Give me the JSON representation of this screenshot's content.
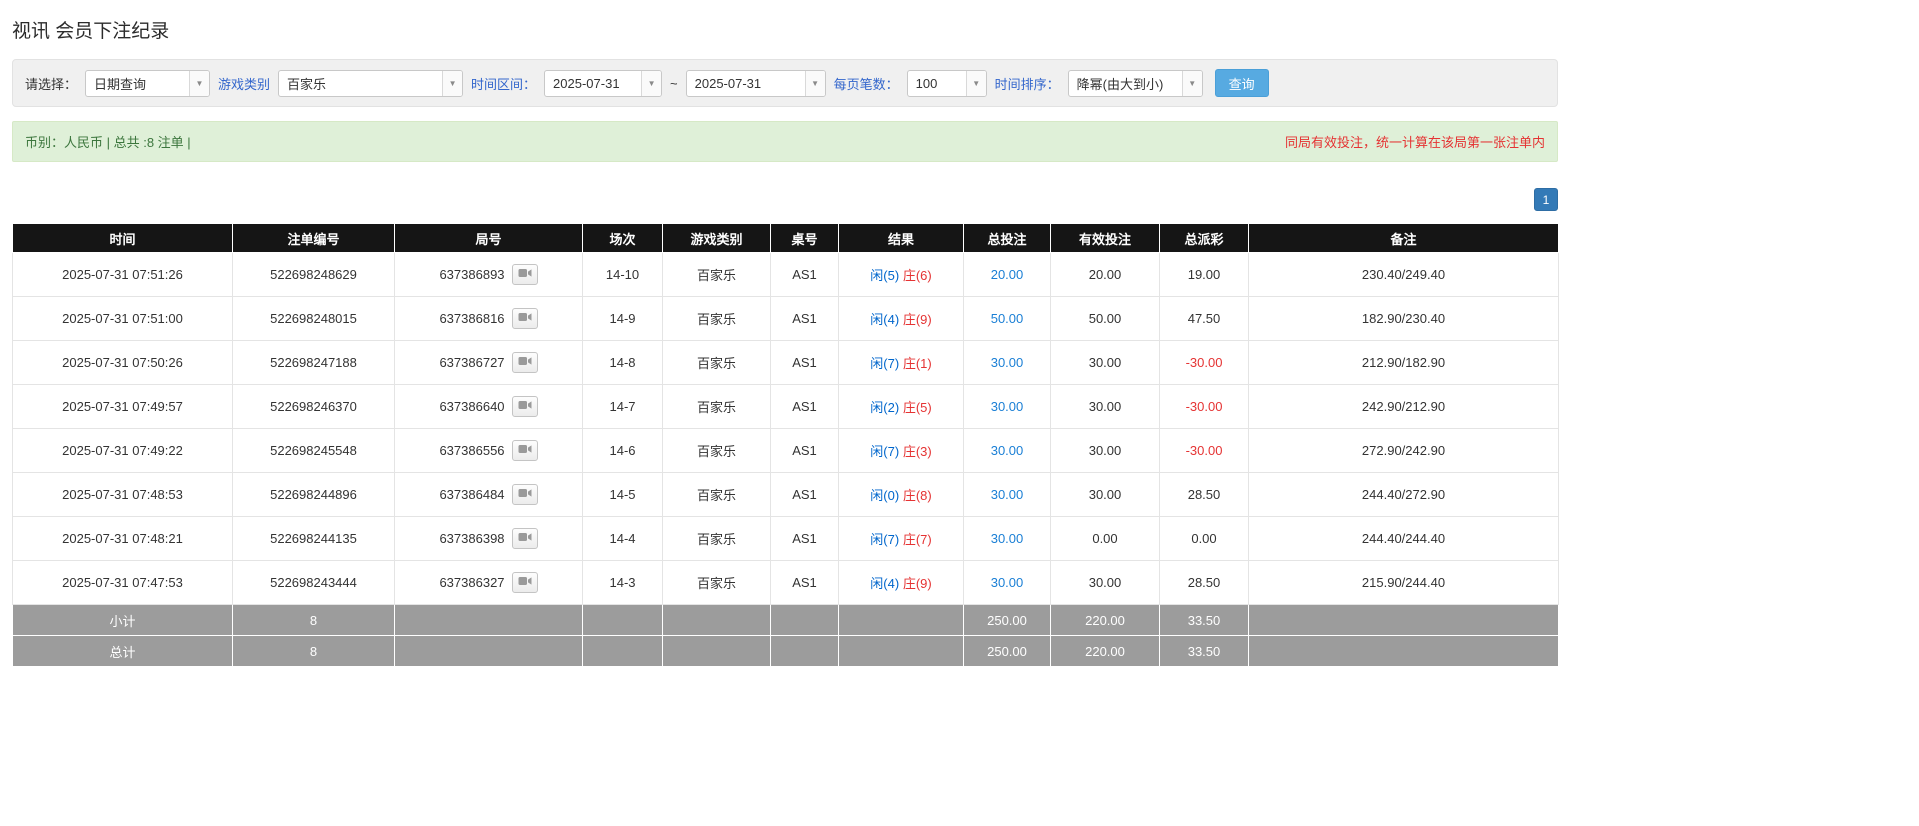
{
  "page": {
    "title": "视讯 会员下注纪录"
  },
  "filters": {
    "select_label": "请选择：",
    "select_value": "日期查询",
    "game_type_label": "游戏类别",
    "game_type_value": "百家乐",
    "time_range_label": "时间区间：",
    "date_from": "2025-07-31",
    "range_separator": "~",
    "date_to": "2025-07-31",
    "page_size_label": "每页笔数：",
    "page_size_value": "100",
    "sort_label": "时间排序：",
    "sort_value": "降幂(由大到小)",
    "search_button": "查询"
  },
  "summary": {
    "currency_info": "币别：人民币 | 总共 :8 注单 |",
    "notice": "同局有效投注，统一计算在该局第一张注单内"
  },
  "pagination": {
    "current_page": "1"
  },
  "table": {
    "headers": [
      "时间",
      "注单编号",
      "局号",
      "场次",
      "游戏类别",
      "桌号",
      "结果",
      "总投注",
      "有效投注",
      "总派彩",
      "备注"
    ],
    "rows": [
      {
        "time": "2025-07-31 07:51:26",
        "bet_id": "522698248629",
        "round_id": "637386893",
        "session": "14-10",
        "game": "百家乐",
        "table_no": "AS1",
        "result_player": "闲(5)",
        "result_banker": "庄(6)",
        "total_bet": "20.00",
        "valid_bet": "20.00",
        "payout": "19.00",
        "remark": "230.40/249.40"
      },
      {
        "time": "2025-07-31 07:51:00",
        "bet_id": "522698248015",
        "round_id": "637386816",
        "session": "14-9",
        "game": "百家乐",
        "table_no": "AS1",
        "result_player": "闲(4)",
        "result_banker": "庄(9)",
        "total_bet": "50.00",
        "valid_bet": "50.00",
        "payout": "47.50",
        "remark": "182.90/230.40"
      },
      {
        "time": "2025-07-31 07:50:26",
        "bet_id": "522698247188",
        "round_id": "637386727",
        "session": "14-8",
        "game": "百家乐",
        "table_no": "AS1",
        "result_player": "闲(7)",
        "result_banker": "庄(1)",
        "total_bet": "30.00",
        "valid_bet": "30.00",
        "payout": "-30.00",
        "remark": "212.90/182.90"
      },
      {
        "time": "2025-07-31 07:49:57",
        "bet_id": "522698246370",
        "round_id": "637386640",
        "session": "14-7",
        "game": "百家乐",
        "table_no": "AS1",
        "result_player": "闲(2)",
        "result_banker": "庄(5)",
        "total_bet": "30.00",
        "valid_bet": "30.00",
        "payout": "-30.00",
        "remark": "242.90/212.90"
      },
      {
        "time": "2025-07-31 07:49:22",
        "bet_id": "522698245548",
        "round_id": "637386556",
        "session": "14-6",
        "game": "百家乐",
        "table_no": "AS1",
        "result_player": "闲(7)",
        "result_banker": "庄(3)",
        "total_bet": "30.00",
        "valid_bet": "30.00",
        "payout": "-30.00",
        "remark": "272.90/242.90"
      },
      {
        "time": "2025-07-31 07:48:53",
        "bet_id": "522698244896",
        "round_id": "637386484",
        "session": "14-5",
        "game": "百家乐",
        "table_no": "AS1",
        "result_player": "闲(0)",
        "result_banker": "庄(8)",
        "total_bet": "30.00",
        "valid_bet": "30.00",
        "payout": "28.50",
        "remark": "244.40/272.90"
      },
      {
        "time": "2025-07-31 07:48:21",
        "bet_id": "522698244135",
        "round_id": "637386398",
        "session": "14-4",
        "game": "百家乐",
        "table_no": "AS1",
        "result_player": "闲(7)",
        "result_banker": "庄(7)",
        "total_bet": "30.00",
        "valid_bet": "0.00",
        "payout": "0.00",
        "remark": "244.40/244.40"
      },
      {
        "time": "2025-07-31 07:47:53",
        "bet_id": "522698243444",
        "round_id": "637386327",
        "session": "14-3",
        "game": "百家乐",
        "table_no": "AS1",
        "result_player": "闲(4)",
        "result_banker": "庄(9)",
        "total_bet": "30.00",
        "valid_bet": "30.00",
        "payout": "28.50",
        "remark": "215.90/244.40"
      }
    ],
    "subtotal": {
      "label": "小计",
      "count": "8",
      "total_bet": "250.00",
      "valid_bet": "220.00",
      "payout": "33.50"
    },
    "total": {
      "label": "总计",
      "count": "8",
      "total_bet": "250.00",
      "valid_bet": "220.00",
      "payout": "33.50"
    }
  },
  "icons": {
    "dropdown_caret": "▼",
    "video_replay": "video-replay-icon"
  },
  "colors": {
    "header_bg": "#151515",
    "footer_bg": "#9c9c9c",
    "label_blue": "#3366cc",
    "link_blue": "#1a7fd5",
    "player_blue": "#0066cc",
    "banker_red": "#e53333",
    "negative_red": "#e53333",
    "search_button_blue": "#57aae1",
    "pagination_blue": "#337ab7",
    "summary_bg": "#dff0d8",
    "summary_text_green": "#3c763d",
    "notice_red": "#e53333"
  }
}
